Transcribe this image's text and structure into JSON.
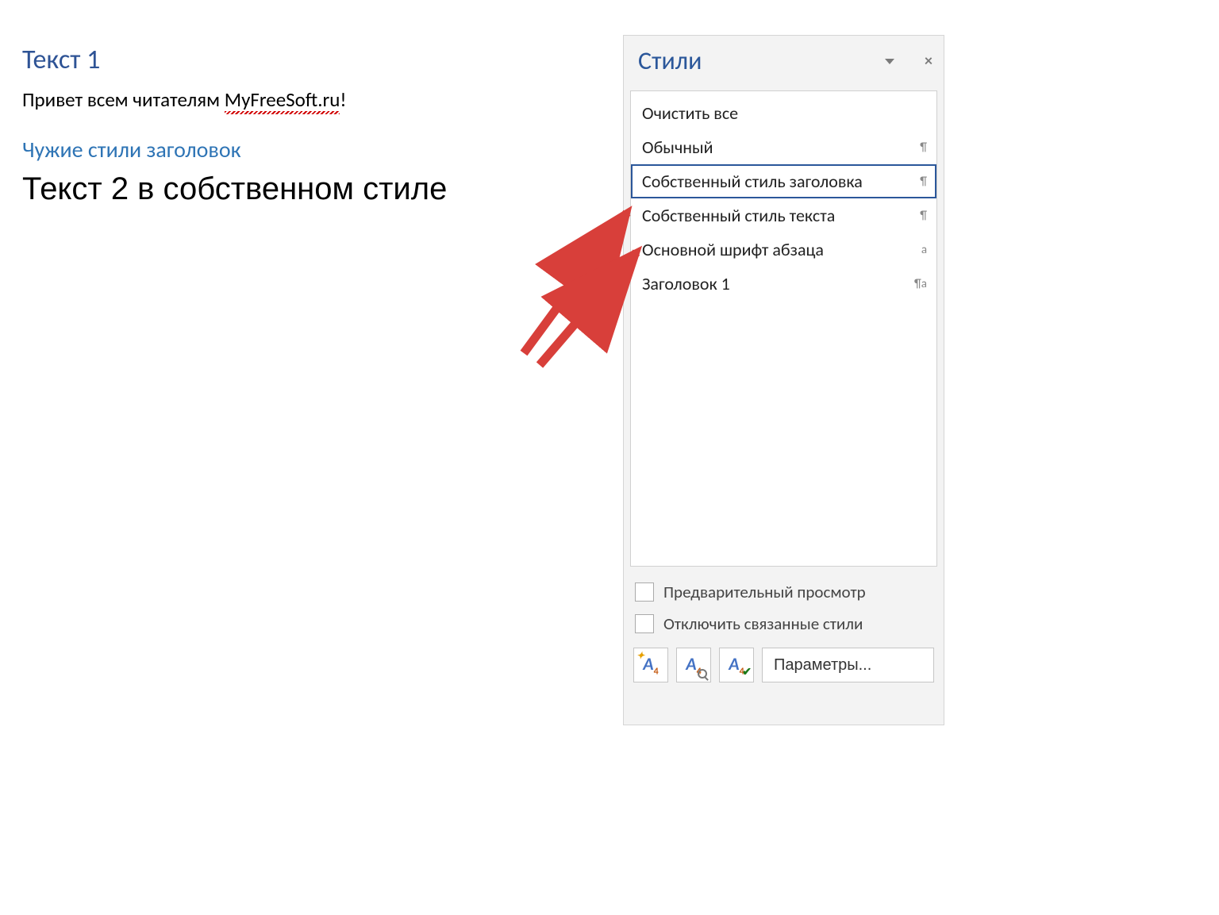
{
  "document": {
    "heading1": "Текст 1",
    "body1_prefix": "Привет всем читателям ",
    "body1_link": "MyFreeSoft.ru",
    "body1_suffix": "!",
    "custom_heading": "Чужие стили заголовок",
    "custom_body": "Текст 2 в собственном стиле"
  },
  "pane": {
    "title": "Стили",
    "items": [
      {
        "label": "Очистить все",
        "marker": ""
      },
      {
        "label": "Обычный",
        "marker": "¶"
      },
      {
        "label": "Собственный стиль заголовка",
        "marker": "¶",
        "selected": true
      },
      {
        "label": "Собственный стиль текста",
        "marker": "¶"
      },
      {
        "label": "Основной шрифт абзаца",
        "marker": "a"
      },
      {
        "label": "Заголовок 1",
        "marker": "¶a"
      }
    ],
    "preview_label": "Предварительный просмотр",
    "disable_linked_label": "Отключить связанные стили",
    "options_button": "Параметры..."
  },
  "colors": {
    "accent": "#2b579a",
    "heading_blue": "#2E74B5",
    "arrow_red": "#D83F3A"
  }
}
